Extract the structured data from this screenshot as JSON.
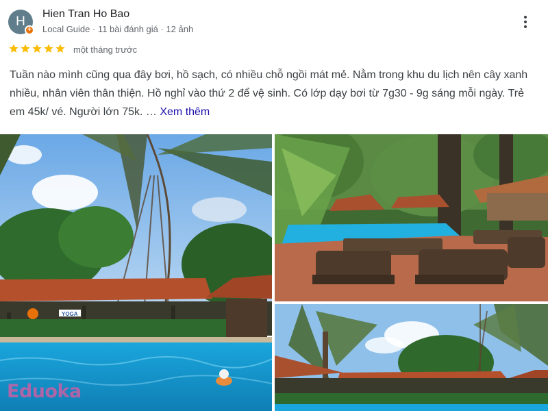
{
  "review": {
    "avatar_letter": "H",
    "reviewer_name": "Hien Tran Ho Bao",
    "reviewer_meta": "Local Guide · 11 bài đánh giá · 12 ảnh",
    "rating": 5,
    "rating_max": 5,
    "time_ago": "một tháng trước",
    "text": "Tuần nào mình cũng qua đây bơi, hồ sạch, có nhiều chỗ ngồi mát mẻ. Nằm trong khu du lịch nên cây xanh nhiều, nhân viên thân thiện. Hồ nghỉ vào thứ 2 để vệ sinh. Có lớp dạy bơi từ 7g30 - 9g sáng mỗi ngày. Trẻ em 45k/ vé. Người lớn 75k. …",
    "see_more": "Xem thêm"
  },
  "photos": [
    {
      "name": "pool-photo-1",
      "sign": "YOGA"
    },
    {
      "name": "pool-photo-2"
    },
    {
      "name": "pool-photo-3"
    }
  ],
  "watermark": "Eduoka",
  "colors": {
    "avatar_bg": "#607d8b",
    "local_guide_badge": "#e8710a",
    "star": "#fbbc04",
    "link": "#1a0dab",
    "pool_water": "#1fa6d8",
    "roof": "#b5502c",
    "watermark": "#e15aa0"
  },
  "icons": [
    "local-guide-badge-icon",
    "star-icon",
    "more-vert-icon"
  ]
}
